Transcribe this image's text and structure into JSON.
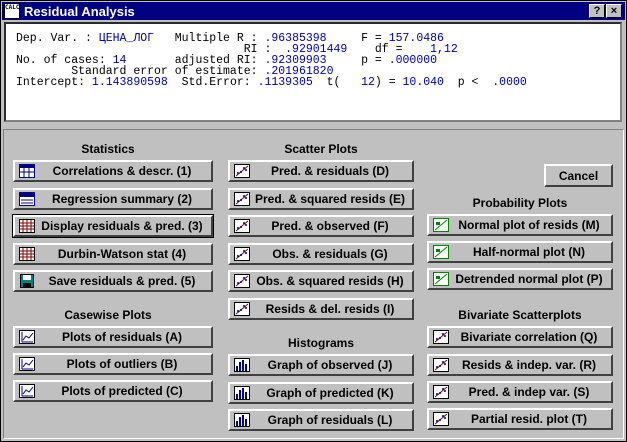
{
  "window": {
    "title": "Residual Analysis",
    "app_icon_text": "CALC",
    "help_label": "?",
    "close_label": "×"
  },
  "results": {
    "lines": [
      [
        "Dep. Var. : ",
        "ЦЕНА_ЛОГ",
        "   Multiple R : ",
        ".96385398",
        "     F = ",
        "157.0486"
      ],
      [
        "                                 RІ :  ",
        ".92901449",
        "    df = ",
        "   1,12"
      ],
      [
        "No. of cases: ",
        "14",
        "       adjusted RІ: ",
        ".92309903",
        "     p = ",
        ".000000"
      ],
      [
        "        Standard error of estimate: ",
        ".201961820"
      ],
      [
        "Intercept: ",
        "1.143890598",
        "  Std.Error: ",
        ".1139305",
        "  t(   ",
        "12",
        ") = ",
        "10.040",
        "  p < ",
        " .0000"
      ]
    ]
  },
  "sections": {
    "statistics": {
      "heading": "Statistics",
      "buttons": [
        {
          "label": "Correlations & descr. (1)",
          "icon": "table-icon"
        },
        {
          "label": "Regression summary (2)",
          "icon": "summary-icon"
        },
        {
          "label": "Display residuals & pred. (3)",
          "icon": "grid-icon"
        },
        {
          "label": "Durbin-Watson stat (4)",
          "icon": "grid-icon"
        },
        {
          "label": "Save residuals & pred. (5)",
          "icon": "disk-icon"
        }
      ]
    },
    "casewise": {
      "heading": "Casewise Plots",
      "buttons": [
        {
          "label": "Plots of residuals (A)",
          "icon": "line-plot-icon"
        },
        {
          "label": "Plots of outliers (B)",
          "icon": "line-plot-icon"
        },
        {
          "label": "Plots of predicted (C)",
          "icon": "line-plot-icon"
        }
      ]
    },
    "scatter": {
      "heading": "Scatter Plots",
      "buttons": [
        {
          "label": "Pred. & residuals (D)",
          "icon": "scatter-icon"
        },
        {
          "label": "Pred. & squared resids (E)",
          "icon": "scatter-icon"
        },
        {
          "label": "Pred. & observed (F)",
          "icon": "scatter-icon"
        },
        {
          "label": "Obs. & residuals (G)",
          "icon": "scatter-icon"
        },
        {
          "label": "Obs. & squared resids (H)",
          "icon": "scatter-icon"
        },
        {
          "label": "Resids & del. resids (I)",
          "icon": "scatter-icon"
        }
      ]
    },
    "histograms": {
      "heading": "Histograms",
      "buttons": [
        {
          "label": "Graph of observed (J)",
          "icon": "histogram-icon"
        },
        {
          "label": "Graph of predicted (K)",
          "icon": "histogram-icon"
        },
        {
          "label": "Graph of residuals (L)",
          "icon": "histogram-icon"
        }
      ]
    },
    "probability": {
      "heading": "Probability Plots",
      "buttons": [
        {
          "label": "Normal plot of resids (M)",
          "icon": "probability-icon"
        },
        {
          "label": "Half-normal plot (N)",
          "icon": "probability-icon"
        },
        {
          "label": "Detrended normal plot (P)",
          "icon": "probability-icon"
        }
      ]
    },
    "bivariate": {
      "heading": "Bivariate Scatterplots",
      "buttons": [
        {
          "label": "Bivariate correlation (Q)",
          "icon": "scatter-icon"
        },
        {
          "label": "Resids & indep. var. (R)",
          "icon": "scatter-icon"
        },
        {
          "label": "Pred. & indep var. (S)",
          "icon": "scatter-icon"
        },
        {
          "label": "Partial resid. plot (T)",
          "icon": "scatter-icon"
        }
      ]
    }
  },
  "cancel_label": "Cancel"
}
